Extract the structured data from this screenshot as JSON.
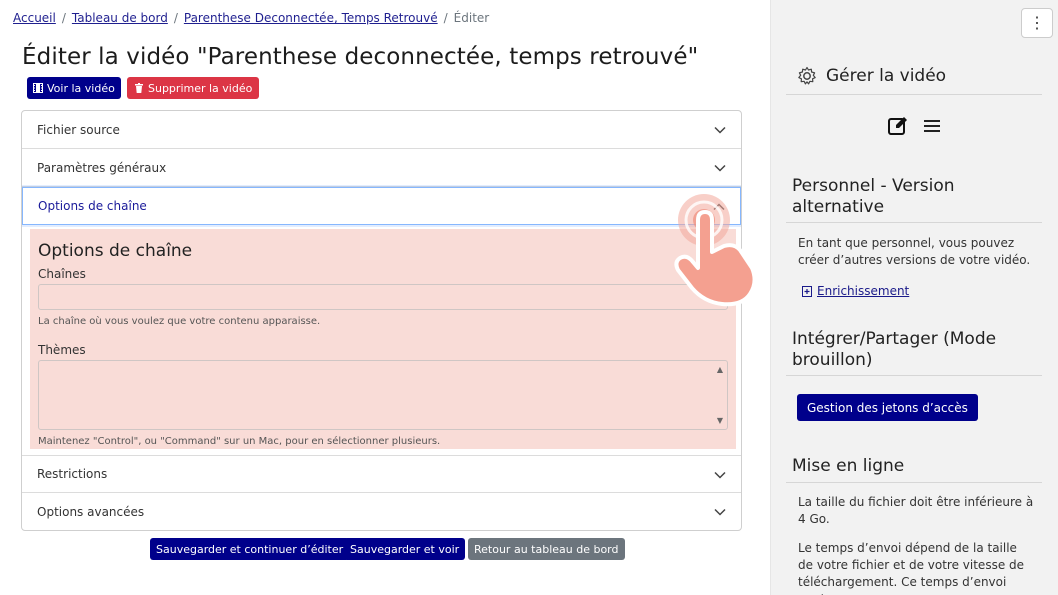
{
  "breadcrumb": {
    "home": "Accueil",
    "dashboard": "Tableau de bord",
    "video": "Parenthese Deconnectée, Temps Retrouvé",
    "current": "Éditer"
  },
  "page": {
    "title": "Éditer la vidéo \"Parenthese deconnectée, temps retrouvé\"",
    "view_button": "Voir la vidéo",
    "delete_button": "Supprimer la vidéo"
  },
  "accordion": {
    "sections": [
      "Fichier source",
      "Paramètres généraux",
      "Options de chaîne",
      "Restrictions",
      "Options avancées"
    ],
    "active": {
      "title": "Options de chaîne",
      "channels_label": "Chaînes",
      "channels_value": "",
      "channels_help": "La chaîne où vous voulez que votre contenu apparaisse.",
      "themes_label": "Thèmes",
      "themes_help": "Maintenez \"Control\", ou \"Command\" sur un Mac, pour en sélectionner plusieurs."
    }
  },
  "actions": {
    "save_continue": "Sauvegarder et continuer d’éditer",
    "save_view": "Sauvegarder et voir",
    "back": "Retour au tableau de bord"
  },
  "sidebar": {
    "manage_title": "Gérer la vidéo",
    "staff_title": "Personnel - Version alternative",
    "staff_text": "En tant que personnel, vous pouvez créer d’autres versions de votre vidéo.",
    "enrichment_link": "Enrichissement",
    "share_title": "Intégrer/Partager (Mode brouillon)",
    "tokens_button": "Gestion des jetons d’accès",
    "upload_title": "Mise en ligne",
    "upload_text_1": "La taille du fichier doit être inférieure à 4 Go.",
    "upload_text_2": "Le temps d’envoi dépend de la taille de votre fichier et de votre vitesse de téléchargement. Ce temps d’envoi peut"
  },
  "icons": {
    "film": "film-icon",
    "trash": "trash-icon",
    "chevron": "chevron-down-icon",
    "gear": "gear-icon",
    "edit": "edit-icon",
    "list": "list-icon",
    "kebab": "kebab-menu-icon",
    "enrich": "plus-square-icon"
  },
  "colors": {
    "primary": "#00008b",
    "danger": "#dc3545",
    "secondary": "#6c757d",
    "panel_bg": "#f9dcd7",
    "sidebar_bg": "#f2f2f2"
  }
}
